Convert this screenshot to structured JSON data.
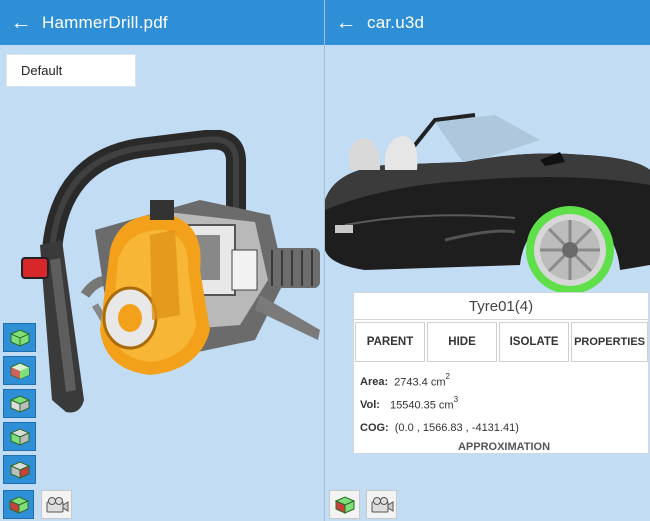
{
  "left": {
    "title": "HammerDrill.pdf",
    "view_select": "Default"
  },
  "right": {
    "title": "car.u3d",
    "popup": {
      "part_name": "Tyre01(4)",
      "buttons": [
        "PARENT",
        "HIDE",
        "ISOLATE",
        "PROPERTIES"
      ],
      "area_label": "Area:",
      "area_value": "2743.4 cm",
      "area_power": "2",
      "vol_label": "Vol:",
      "vol_value": "15540.35 cm",
      "vol_power": "3",
      "cog_label": "COG:",
      "cog_value": "(0.0 , 1566.83 , -4131.41)",
      "approx": "APPROXIMATION"
    }
  },
  "icons": {
    "back": "arrow-left-icon",
    "toolbar": [
      "view-iso-icon",
      "view-front-icon",
      "view-top-icon",
      "view-left-icon",
      "view-right-icon",
      "view-cube-icon"
    ],
    "camera": "camera-icon"
  },
  "colors": {
    "appbar": "#2f8fd6",
    "background": "#c2dcf3",
    "highlight_tyre": "#5fe04a"
  }
}
